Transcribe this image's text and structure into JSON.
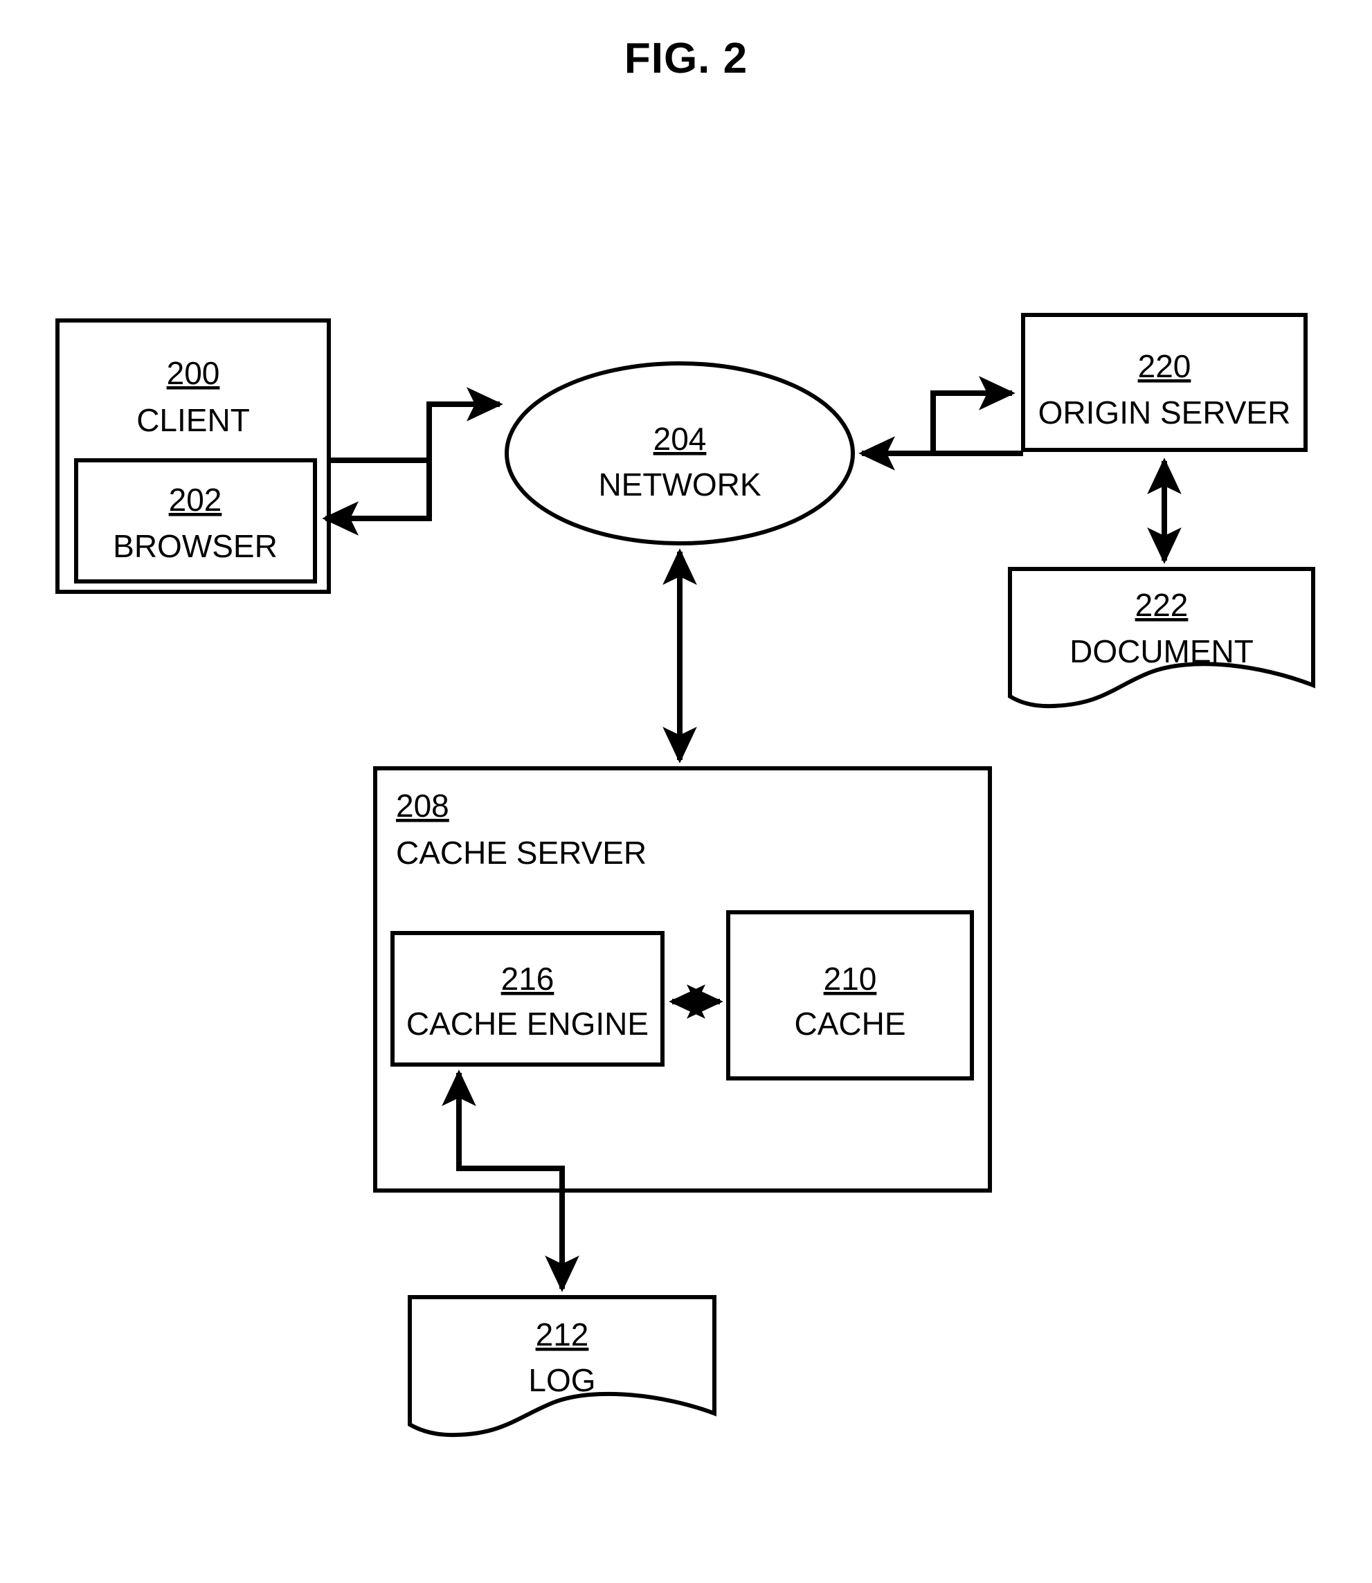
{
  "figure": {
    "title": "FIG. 2",
    "type": "patent-block-diagram"
  },
  "nodes": {
    "client": {
      "ref": "200",
      "label": "CLIENT",
      "shape": "rectangle"
    },
    "browser": {
      "ref": "202",
      "label": "BROWSER",
      "shape": "rectangle"
    },
    "network": {
      "ref": "204",
      "label": "NETWORK",
      "shape": "ellipse"
    },
    "origin_server": {
      "ref": "220",
      "label": "ORIGIN SERVER",
      "shape": "rectangle"
    },
    "document": {
      "ref": "222",
      "label": "DOCUMENT",
      "shape": "document"
    },
    "cache_server": {
      "ref": "208",
      "label": "CACHE SERVER",
      "shape": "rectangle"
    },
    "cache_engine": {
      "ref": "216",
      "label": "CACHE ENGINE",
      "shape": "rectangle"
    },
    "cache": {
      "ref": "210",
      "label": "CACHE",
      "shape": "rectangle"
    },
    "log": {
      "ref": "212",
      "label": "LOG",
      "shape": "document"
    }
  },
  "connectors": [
    {
      "id": "client-to-network",
      "from": "client",
      "to": "network",
      "style": "stepped",
      "direction": "forward"
    },
    {
      "id": "network-to-browser",
      "from": "network",
      "to": "browser",
      "style": "stepped",
      "direction": "forward"
    },
    {
      "id": "network-to-origin-server",
      "from": "network",
      "to": "origin_server",
      "style": "stepped",
      "direction": "forward"
    },
    {
      "id": "origin-server-to-network",
      "from": "origin_server",
      "to": "network",
      "style": "stepped",
      "direction": "forward"
    },
    {
      "id": "origin-server-to-document",
      "from": "origin_server",
      "to": "document",
      "style": "straight",
      "direction": "bidirectional"
    },
    {
      "id": "network-to-cache-server",
      "from": "network",
      "to": "cache_server",
      "style": "straight",
      "direction": "bidirectional"
    },
    {
      "id": "cache-engine-to-cache",
      "from": "cache_engine",
      "to": "cache",
      "style": "straight",
      "direction": "bidirectional"
    },
    {
      "id": "cache-engine-to-log",
      "from": "cache_engine",
      "to": "log",
      "style": "stepped",
      "direction": "bidirectional"
    }
  ],
  "colors": {
    "stroke": "#000000",
    "fill": "#ffffff"
  }
}
